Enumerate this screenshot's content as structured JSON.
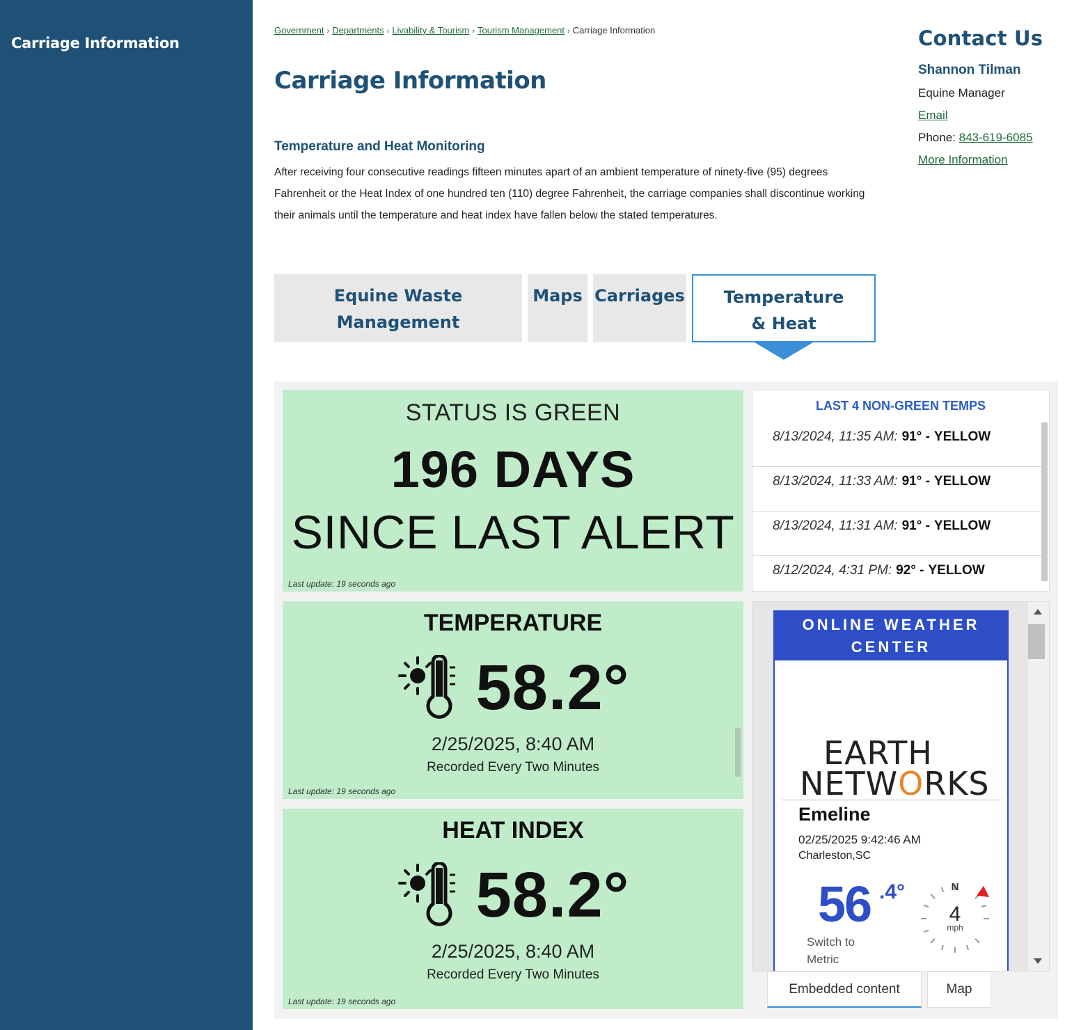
{
  "sidebar": {
    "title": "Carriage Information"
  },
  "breadcrumb": [
    {
      "label": "Government",
      "link": true
    },
    {
      "label": "Departments",
      "link": true
    },
    {
      "label": "Livability & Tourism",
      "link": true
    },
    {
      "label": "Tourism Management",
      "link": true
    },
    {
      "label": "Carriage Information",
      "link": false
    }
  ],
  "page": {
    "title": "Carriage Information",
    "section_title": "Temperature and Heat Monitoring",
    "section_body": "After receiving four consecutive readings fifteen minutes apart of an ambient temperature of ninety-five (95) degrees Fahrenheit or the Heat Index of one hundred ten (110) degree Fahrenheit, the carriage companies shall discontinue working their animals until the temperature and heat index have fallen below the stated temperatures."
  },
  "contact": {
    "heading": "Contact Us",
    "name": "Shannon Tilman",
    "role": "Equine Manager",
    "email_label": "Email",
    "phone_label": "Phone:",
    "phone": "843-619-6085",
    "more_label": "More Information"
  },
  "tabs": [
    {
      "label": "Equine Waste Management",
      "active": false
    },
    {
      "label": "Maps",
      "active": false
    },
    {
      "label": "Carriages",
      "active": false
    },
    {
      "label": "Temperature & Heat",
      "active": true
    }
  ],
  "status": {
    "label": "STATUS IS GREEN",
    "days": "196 DAYS",
    "since": "SINCE LAST ALERT",
    "last_update": "Last update: 19 seconds ago"
  },
  "temperature": {
    "title": "TEMPERATURE",
    "value": "58.2°",
    "date": "2/25/2025, 8:40 AM",
    "sub": "Recorded Every Two Minutes",
    "last_update": "Last update: 19 seconds ago",
    "icon": "sun-thermometer-icon"
  },
  "heat_index": {
    "title": "HEAT INDEX",
    "value": "58.2°",
    "date": "2/25/2025, 8:40 AM",
    "sub": "Recorded Every Two Minutes",
    "last_update": "Last update: 19 seconds ago",
    "icon": "sun-thermometer-icon"
  },
  "non_green": {
    "title": "LAST 4 NON-GREEN TEMPS",
    "rows": [
      {
        "ts": "8/13/2024, 11:35 AM:",
        "val": "91° -",
        "level": "YELLOW"
      },
      {
        "ts": "8/13/2024, 11:33 AM:",
        "val": "91° -",
        "level": "YELLOW"
      },
      {
        "ts": "8/13/2024, 11:31 AM:",
        "val": "91° -",
        "level": "YELLOW"
      },
      {
        "ts": "8/12/2024, 4:31 PM:",
        "val": "92° -",
        "level": "YELLOW"
      }
    ]
  },
  "weather": {
    "header": "ONLINE WEATHER CENTER",
    "logo_line1": "EARTH",
    "logo_line2_a": "NETW",
    "logo_line2_o": "O",
    "logo_line2_b": "RKS",
    "station": "Emeline",
    "time": "02/25/2025 9:42:46 AM",
    "location": "Charleston,SC",
    "temp": "56",
    "temp_dec": ".4°",
    "metric_line1": "Switch to",
    "metric_line2": "Metric",
    "wind_dir": "N",
    "wind_speed": "4",
    "wind_unit": "mph"
  },
  "embed_tabs": [
    {
      "label": "Embedded content",
      "active": true
    },
    {
      "label": "Map",
      "active": false
    }
  ],
  "colors": {
    "brand": "#1f5176",
    "green_card": "#c0ecca",
    "accent_blue": "#2d4ec7",
    "link_green": "#1f6a3a"
  }
}
